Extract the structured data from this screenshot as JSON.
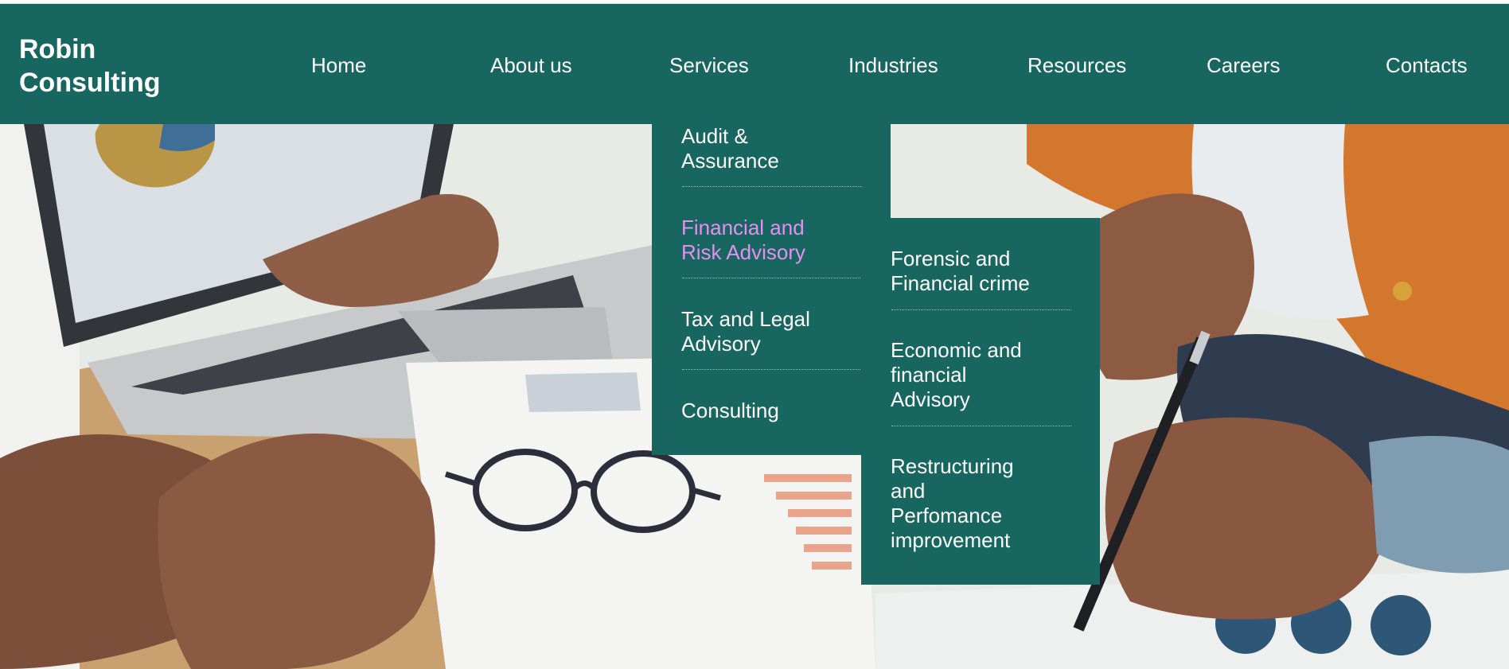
{
  "brand": {
    "line1": "Robin",
    "line2": "Consulting"
  },
  "nav": [
    {
      "label": "Home"
    },
    {
      "label": "About us"
    },
    {
      "label": "Services"
    },
    {
      "label": "Industries"
    },
    {
      "label": "Resources"
    },
    {
      "label": "Careers"
    },
    {
      "label": "Contacts"
    }
  ],
  "services_menu": [
    {
      "line1": "Audit &",
      "line2": "Assurance"
    },
    {
      "line1": "Financial and",
      "line2": "Risk Advisory",
      "active": true
    },
    {
      "line1": "Tax and Legal",
      "line2": "Advisory"
    },
    {
      "line1": "Consulting"
    }
  ],
  "advisory_submenu": [
    {
      "line1": "Forensic and",
      "line2": "Financial crime"
    },
    {
      "line1": "Economic and",
      "line2": "financial",
      "line3": "Advisory"
    },
    {
      "line1": "Restructuring",
      "line2": "and",
      "line3": "Perfomance",
      "line4": "improvement"
    }
  ],
  "colors": {
    "nav_bg": "#176660",
    "text": "#ffffff",
    "active_item": "#e58ff0"
  },
  "hero": {
    "image": "business-meeting-photo"
  }
}
